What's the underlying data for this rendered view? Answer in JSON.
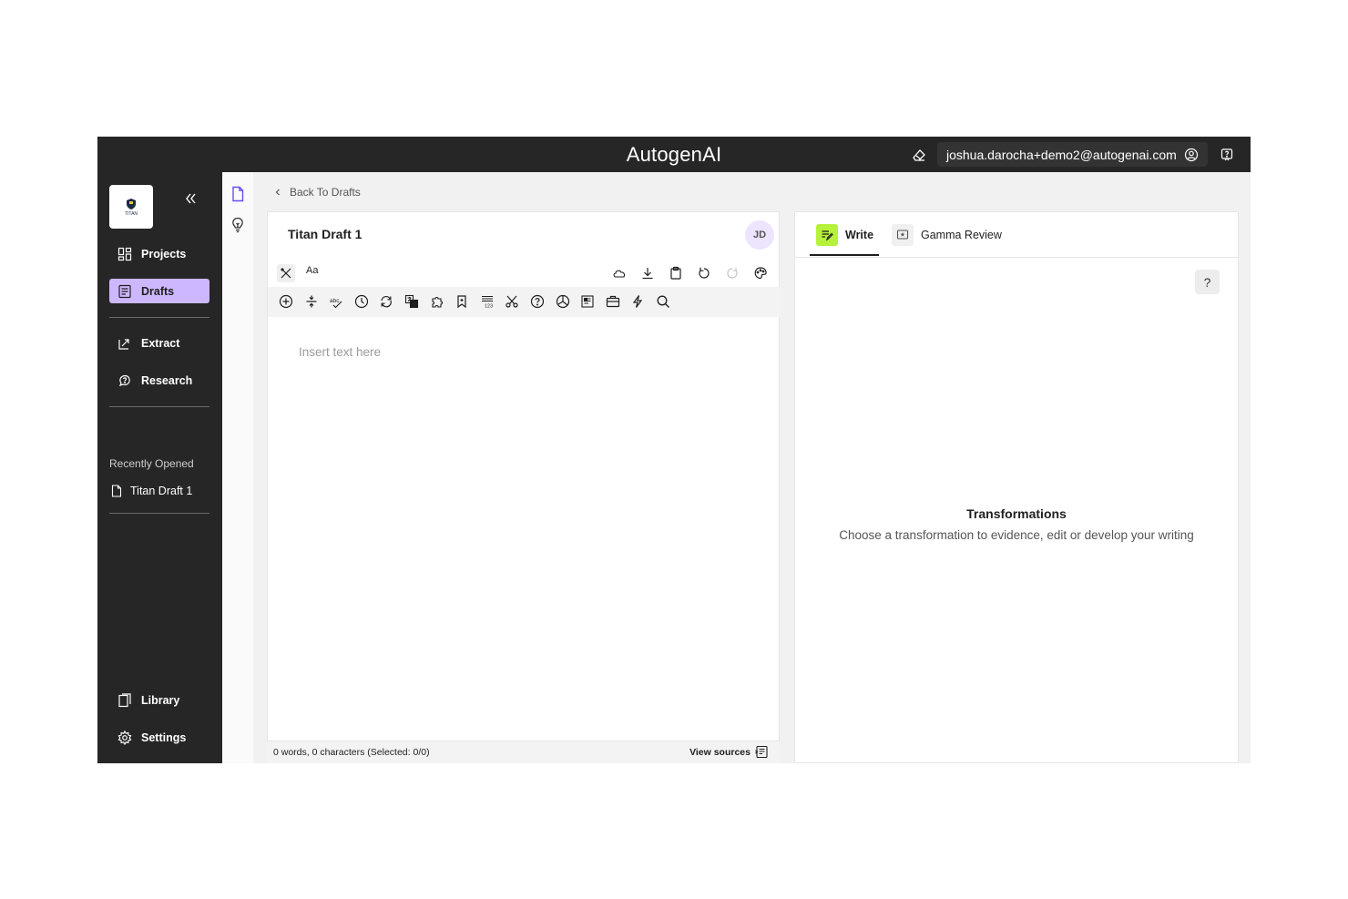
{
  "topbar": {
    "brand": "AutogenAI",
    "account_email": "joshua.darocha+demo2@autogenai.com",
    "icons": [
      "eraser-icon",
      "user-circle-icon",
      "help-chat-icon"
    ]
  },
  "sidebar": {
    "logo_text": "TITAN",
    "nav": [
      {
        "label": "Projects",
        "icon": "grid-icon"
      },
      {
        "label": "Drafts",
        "icon": "document-list-icon",
        "active": true
      },
      {
        "label": "Extract",
        "icon": "extract-icon"
      },
      {
        "label": "Research",
        "icon": "research-icon"
      }
    ],
    "recently_opened_heading": "Recently Opened",
    "recent_items": [
      {
        "label": "Titan Draft 1",
        "icon": "file-icon"
      }
    ],
    "bottom_nav": [
      {
        "label": "Library",
        "icon": "library-icon"
      },
      {
        "label": "Settings",
        "icon": "gear-icon"
      }
    ]
  },
  "breadcrumb": {
    "back_label": "Back To Drafts"
  },
  "editor": {
    "title": "Titan Draft 1",
    "avatar_initials": "JD",
    "font_button": "Aa",
    "placeholder": "Insert text here",
    "counts": "0 words, 0 characters (Selected: 0/0)",
    "view_sources": "View sources"
  },
  "right_panel": {
    "tabs": [
      {
        "label": "Write",
        "active": true
      },
      {
        "label": "Gamma Review"
      }
    ],
    "help_label": "?",
    "empty_title": "Transformations",
    "empty_description": "Choose a transformation to evidence, edit or develop your writing"
  },
  "colors": {
    "topbar_bg": "#262626",
    "sidebar_bg": "#262626",
    "active_nav": "#cdb8ff",
    "write_tab_accent": "#b7f23a",
    "rail_icon_accent": "#6b4cf0"
  }
}
